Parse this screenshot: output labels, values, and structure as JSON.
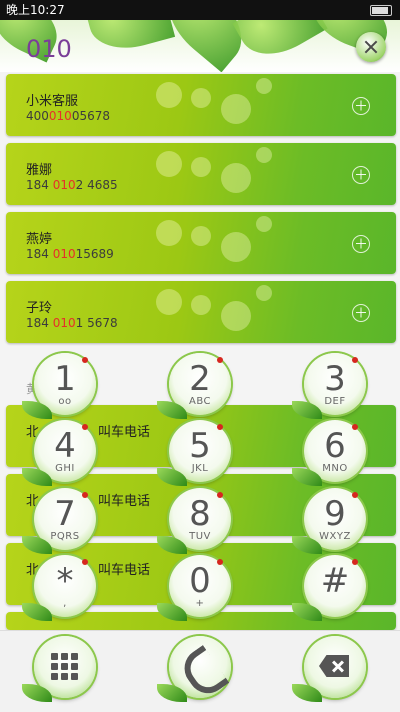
{
  "status": {
    "time": "晚上10:27"
  },
  "dialer": {
    "input_value": "010"
  },
  "contacts": [
    {
      "name": "小米客服",
      "num_pre": "400",
      "num_hl": "010",
      "num_post": "05678"
    },
    {
      "name": "雅娜",
      "num_pre": "184 ",
      "num_hl": "010",
      "num_post": "2 4685"
    },
    {
      "name": "燕婷",
      "num_pre": "184 ",
      "num_hl": "010",
      "num_post": "15689"
    },
    {
      "name": "子玲",
      "num_pre": "184 ",
      "num_hl": "010",
      "num_post": "1 5678"
    }
  ],
  "section": {
    "label": "黄"
  },
  "partial_rows": [
    {
      "left": "北",
      "right": "叫车电话"
    },
    {
      "left": "北",
      "right": "叫车电话"
    },
    {
      "left": "北",
      "right": "叫车电话"
    }
  ],
  "keypad": [
    {
      "digit": "1",
      "letters": "ᴏᴏ"
    },
    {
      "digit": "2",
      "letters": "ABC"
    },
    {
      "digit": "3",
      "letters": "DEF"
    },
    {
      "digit": "4",
      "letters": "GHI"
    },
    {
      "digit": "5",
      "letters": "JKL"
    },
    {
      "digit": "6",
      "letters": "MNO"
    },
    {
      "digit": "7",
      "letters": "PQRS"
    },
    {
      "digit": "8",
      "letters": "TUV"
    },
    {
      "digit": "9",
      "letters": "WXYZ"
    },
    {
      "digit": "*",
      "letters": ","
    },
    {
      "digit": "0",
      "letters": "+"
    },
    {
      "digit": "#",
      "letters": ""
    }
  ],
  "icons": {
    "keypad_toggle": "grid-icon",
    "call": "phone-icon",
    "delete": "backspace-icon",
    "corner": "close-icon"
  },
  "colors": {
    "accent": "#7a3e98",
    "highlight": "#e5302a",
    "theme_green": "#8cc84b"
  }
}
